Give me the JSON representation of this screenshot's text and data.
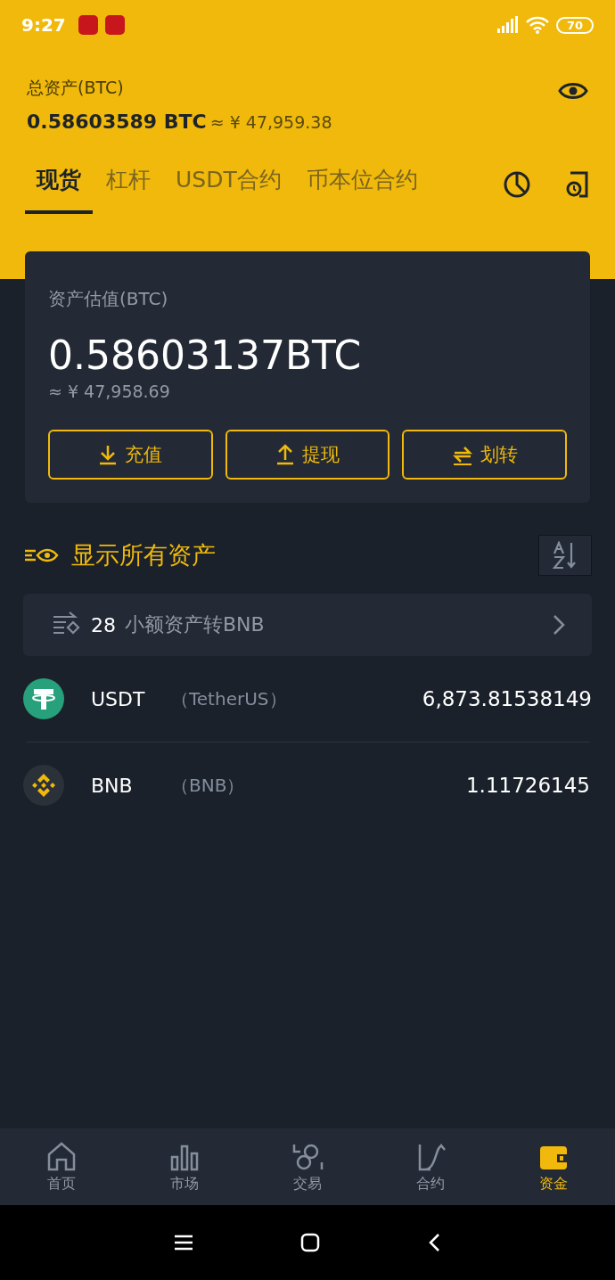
{
  "status_bar": {
    "time": "9:27",
    "battery": "70"
  },
  "header": {
    "title": "总资产(BTC)",
    "total": "0.58603589 BTC",
    "approx": "≈ ¥ 47,959.38"
  },
  "tabs": [
    {
      "label": "现货",
      "selected": true
    },
    {
      "label": "杠杆",
      "selected": false
    },
    {
      "label": "USDT合约",
      "selected": false
    },
    {
      "label": "币本位合约",
      "selected": false
    }
  ],
  "card": {
    "title": "资产估值(BTC)",
    "value": "0.58603137BTC",
    "approx": "≈ ¥ 47,958.69",
    "buttons": [
      {
        "label": "充值",
        "kind": "deposit"
      },
      {
        "label": "提现",
        "kind": "withdraw"
      },
      {
        "label": "划转",
        "kind": "transfer"
      }
    ]
  },
  "show_all": {
    "label": "显示所有资产"
  },
  "small_assets": {
    "count": "28",
    "label": "小额资产转BNB"
  },
  "assets": [
    {
      "symbol": "USDT",
      "name": "（TetherUS）",
      "amount": "6,873.81538149",
      "kind": "usdt"
    },
    {
      "symbol": "BNB",
      "name": "（BNB）",
      "amount": "1.11726145",
      "kind": "bnb"
    }
  ],
  "bottom_nav": [
    {
      "label": "首页",
      "kind": "home",
      "selected": false
    },
    {
      "label": "市场",
      "kind": "market",
      "selected": false
    },
    {
      "label": "交易",
      "kind": "trade",
      "selected": false
    },
    {
      "label": "合约",
      "kind": "futures",
      "selected": false
    },
    {
      "label": "资金",
      "kind": "wallet",
      "selected": true
    }
  ]
}
